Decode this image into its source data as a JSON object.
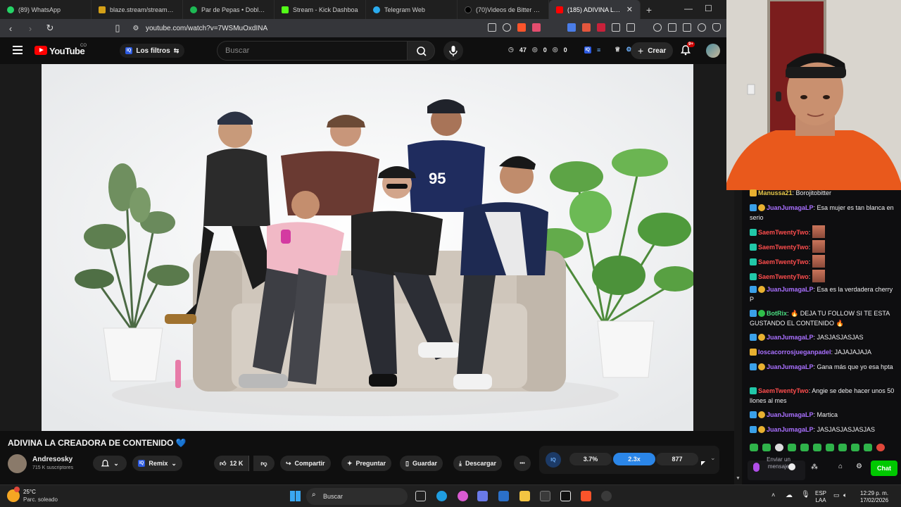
{
  "browser": {
    "tabs": [
      {
        "label": "(89) WhatsApp",
        "color": "#25d366"
      },
      {
        "label": "blaze.stream/stream-setting",
        "color": "#d4a017"
      },
      {
        "label": "Par de Pepas • Doble P",
        "color": "#1db954"
      },
      {
        "label": "Stream - Kick Dashboa",
        "color": "#53fc18"
      },
      {
        "label": "Telegram Web",
        "color": "#2aabee"
      },
      {
        "label": "(70)Videos de Bitter 123 (@",
        "color": "#111111"
      },
      {
        "label": "(185) ADIVINA LA CRE",
        "color": "#ff0000",
        "active": true
      }
    ],
    "new_tab": "+",
    "url": "youtube.com/watch?v=7WSMuOxdINA"
  },
  "youtube": {
    "logo_text": "YouTube",
    "country": "CO",
    "filters_badge": "IQ",
    "filters_label": "Los filtros",
    "search_placeholder": "Buscar",
    "counters": {
      "a": "47",
      "b": "0",
      "c": "0"
    },
    "create_label": "Crear",
    "notifications": "9+"
  },
  "video": {
    "title": "ADIVINA LA CREADORA DE CONTENIDO",
    "title_emoji": "💙",
    "channel": "Andresosky",
    "subscribers": "715 K suscriptores",
    "remix_badge": "IQ",
    "remix_label": "Remix",
    "likes": "12 K",
    "share": "Compartir",
    "ask": "Preguntar",
    "save": "Guardar",
    "download": "Descargar",
    "more": "•••",
    "stats": {
      "badge": "IQ",
      "ratio": "3.7%",
      "speed": "2.3x",
      "count": "877"
    }
  },
  "chat": {
    "messages": [
      {
        "user": "Manussa21",
        "color": "#e8c94a",
        "text": ": Borojitobitter"
      },
      {
        "user": "JuanJumagaLP",
        "color": "#a970ff",
        "text": ": Esa mujer es tan blanca en serio"
      },
      {
        "user": "SaemTwentyTwo",
        "color": "#ff4d4d",
        "text": ":"
      },
      {
        "user": "SaemTwentyTwo",
        "color": "#ff4d4d",
        "text": ":"
      },
      {
        "user": "SaemTwentyTwo",
        "color": "#ff4d4d",
        "text": ":"
      },
      {
        "user": "SaemTwentyTwo",
        "color": "#ff4d4d",
        "text": ":"
      },
      {
        "user": "JuanJumagaLP",
        "color": "#a970ff",
        "text": ": Esa es la verdadera cherry P"
      },
      {
        "user": "BotRix",
        "color": "#4ade80",
        "text": ": 🔥 DEJA TU FOLLOW SI TE ESTA GUSTANDO EL CONTENIDO 🔥"
      },
      {
        "user": "JuanJumagaLP",
        "color": "#a970ff",
        "text": ": JASJASJASJAS"
      },
      {
        "user": "loscacorrosjueganpadel",
        "color": "#a970ff",
        "text": ": JAJAJAJAJA"
      },
      {
        "user": "JuanJumagaLP",
        "color": "#a970ff",
        "text": ": Gana más que yo esa hpta"
      },
      {
        "user": "SaemTwentyTwo",
        "color": "#ff4d4d",
        "text": ": Angie se debe hacer unos 50 llones al mes"
      },
      {
        "user": "JuanJumagaLP",
        "color": "#a970ff",
        "text": ": Martica"
      },
      {
        "user": "JuanJumagaLP",
        "color": "#a970ff",
        "text": ": JASJASJASJASJAS"
      }
    ],
    "input_placeholder": "Enviar un mensaje",
    "chat_button": "Chat"
  },
  "taskbar": {
    "temperature": "25°C",
    "weather": "Parc. soleado",
    "search": "Buscar",
    "lang": "ESP",
    "region": "LAA",
    "time": "12:29 p. m.",
    "date": "17/02/2026"
  }
}
